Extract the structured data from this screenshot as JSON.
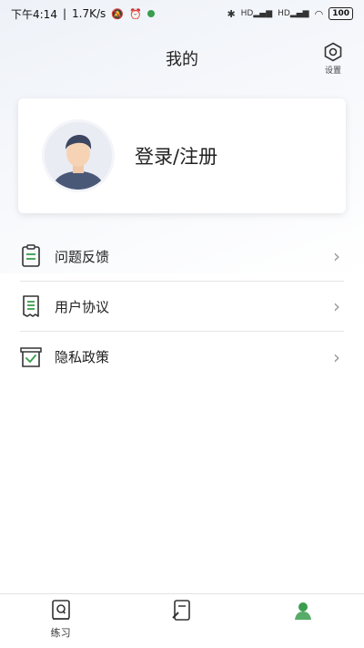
{
  "status_bar": {
    "time": "下午4:14",
    "speed": "1.7K/s",
    "battery": "100",
    "network_1": "HD",
    "network_2": "HD"
  },
  "header": {
    "title": "我的"
  },
  "settings": {
    "label": "设置",
    "icon": "hexagon-gear-icon"
  },
  "profile": {
    "login_label": "登录/注册",
    "avatar": "user-avatar-icon"
  },
  "menu": {
    "items": [
      {
        "label": "问题反馈",
        "icon": "clipboard-icon"
      },
      {
        "label": "用户协议",
        "icon": "receipt-icon"
      },
      {
        "label": "隐私政策",
        "icon": "check-doc-icon"
      }
    ]
  },
  "tabs": [
    {
      "label": "练习",
      "icon": "q-book-icon"
    },
    {
      "label": "",
      "icon": "doc-pencil-icon"
    },
    {
      "label": "",
      "icon": "user-icon"
    }
  ],
  "colors": {
    "accent": "#3a9d4f",
    "text": "#222222",
    "divider": "#e6e6e6"
  }
}
